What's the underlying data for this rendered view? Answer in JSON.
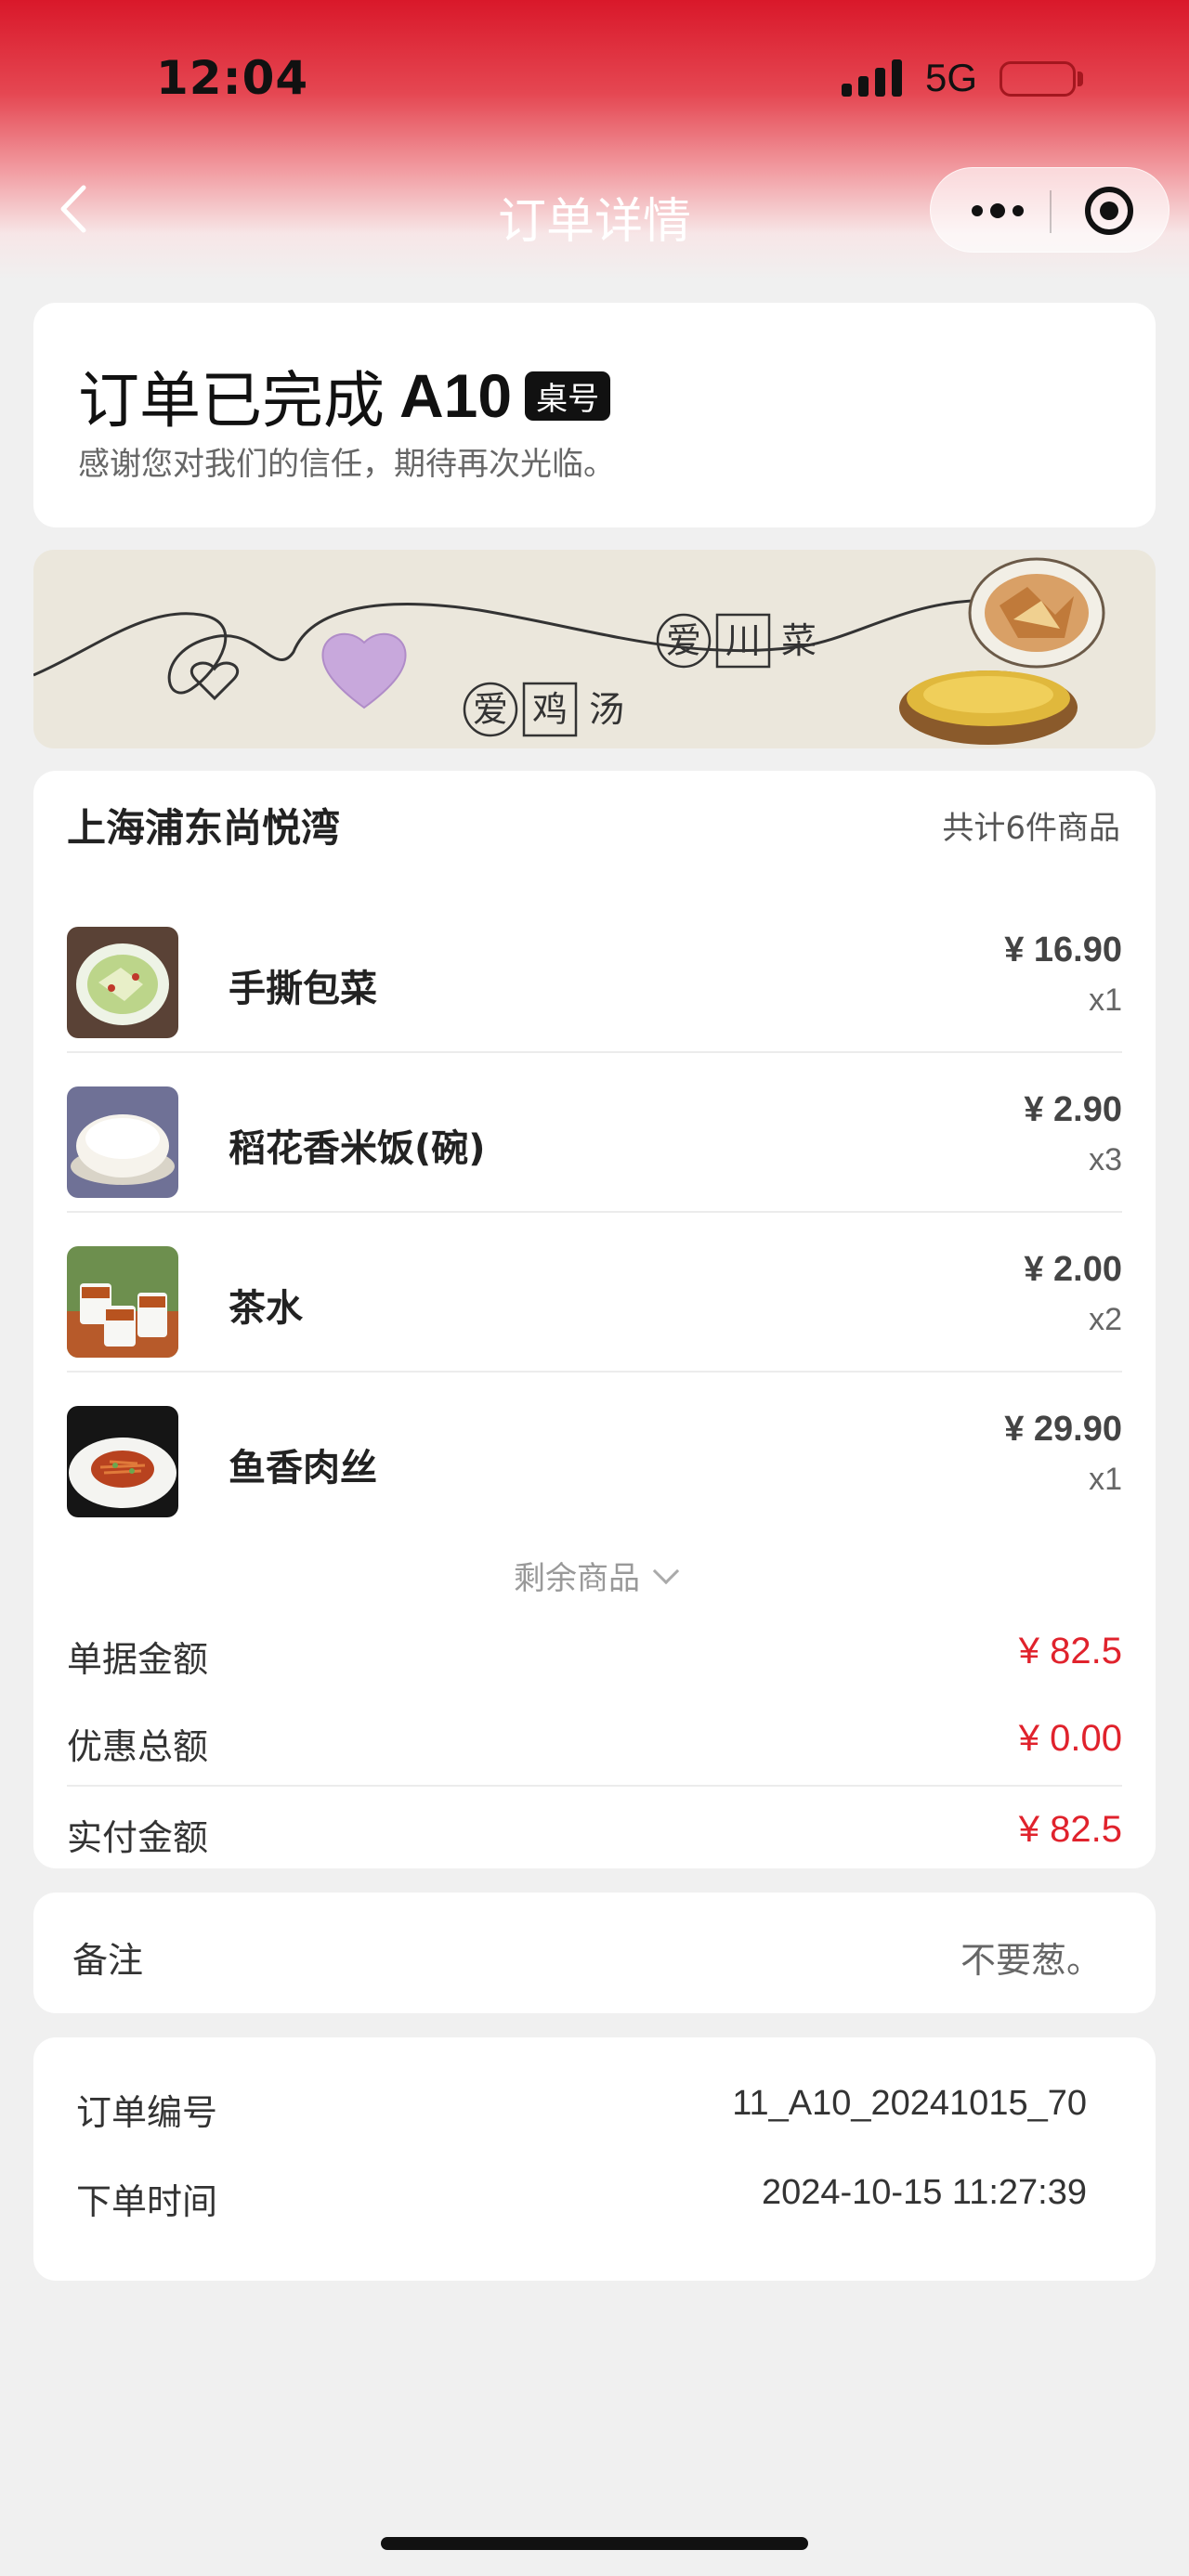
{
  "status_bar": {
    "time": "12:04",
    "network": "5G"
  },
  "nav": {
    "title": "订单详情",
    "back_icon": "chevron-left-icon",
    "more_icon": "more-dots-icon",
    "close_icon": "target-close-icon"
  },
  "order_status": {
    "title": "订单已完成",
    "table_number": "A10",
    "table_badge": "桌号",
    "subtitle": "感谢您对我们的信任，期待再次光临。"
  },
  "banner": {
    "text_top": [
      "爱",
      "川",
      "菜"
    ],
    "text_bottom": [
      "爱",
      "鸡",
      "汤"
    ]
  },
  "store": {
    "name": "上海浦东尚悦湾",
    "item_count_label": "共计6件商品"
  },
  "items": [
    {
      "name": "手撕包菜",
      "price": "¥ 16.90",
      "qty": "x1",
      "thumb_colors": [
        "#5a4236",
        "#c8d8a0",
        "#8fb36a"
      ]
    },
    {
      "name": "稻花香米饭(碗)",
      "price": "¥ 2.90",
      "qty": "x3",
      "thumb_colors": [
        "#6f7196",
        "#f4f1ea",
        "#d9d4c8"
      ]
    },
    {
      "name": "茶水",
      "price": "¥ 2.00",
      "qty": "x2",
      "thumb_colors": [
        "#3f6e3a",
        "#f5f5f2",
        "#c2562a"
      ]
    },
    {
      "name": "鱼香肉丝",
      "price": "¥ 29.90",
      "qty": "x1",
      "thumb_colors": [
        "#1a1a1a",
        "#f7f7f4",
        "#b8421f"
      ]
    }
  ],
  "more_items_label": "剩余商品",
  "summary": [
    {
      "label": "单据金额",
      "value": "¥ 82.5"
    },
    {
      "label": "优惠总额",
      "value": "¥ 0.00"
    },
    {
      "label": "实付金额",
      "value": "¥ 82.5"
    }
  ],
  "remark": {
    "label": "备注",
    "value": "不要葱。"
  },
  "order_info": [
    {
      "label": "订单编号",
      "value": "11_A10_20241015_70"
    },
    {
      "label": "下单时间",
      "value": "2024-10-15 11:27:39"
    }
  ],
  "colors": {
    "brand_red": "#d9182a",
    "price_red": "#e0222c"
  }
}
